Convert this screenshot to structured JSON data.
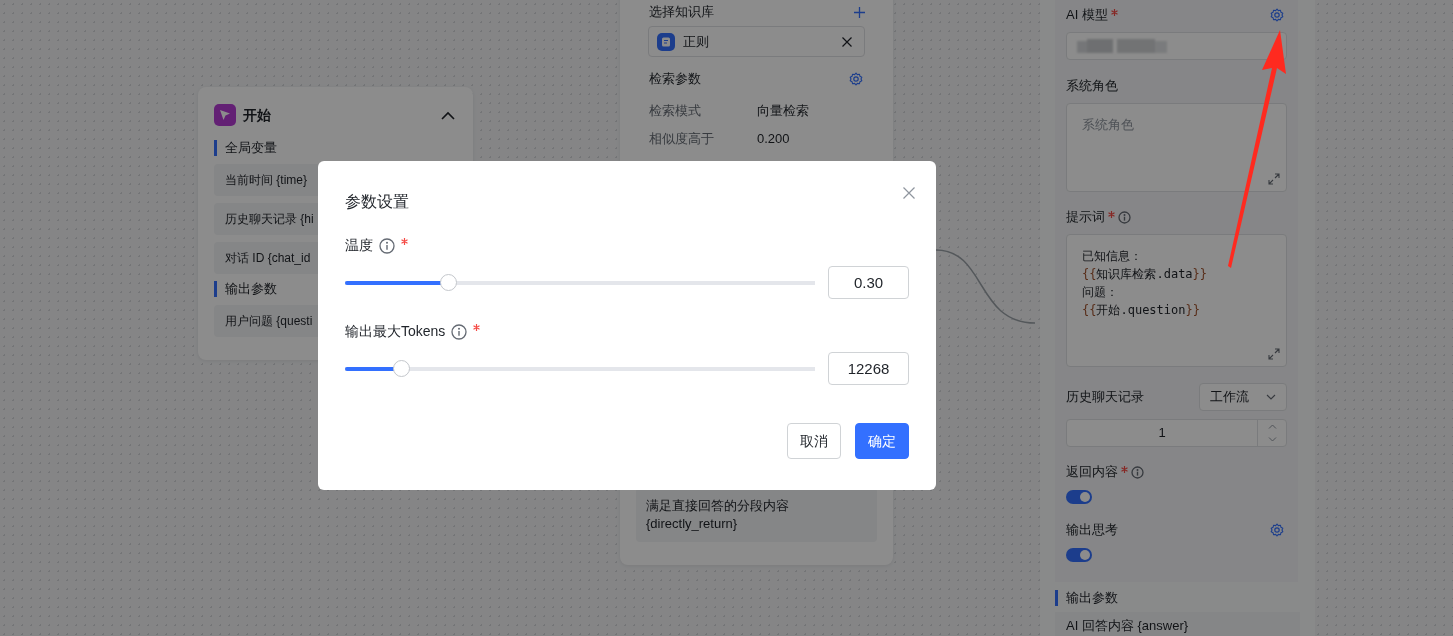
{
  "start_node": {
    "title": "开始",
    "expanded": true,
    "sections": [
      {
        "heading": "全局变量",
        "items": [
          "当前时间 {time}",
          "历史聊天记录 {hi",
          "对话 ID {chat_id"
        ]
      },
      {
        "heading": "输出参数",
        "items": [
          "用户问题 {questi"
        ]
      }
    ]
  },
  "knowledge_node": {
    "kb_label": "选择知识库",
    "knowledge_bases": [
      {
        "name": "正则"
      }
    ],
    "params_title": "检索参数",
    "params": [
      {
        "label": "检索模式",
        "value": "向量检索"
      },
      {
        "label": "相似度高于",
        "value": "0.200"
      }
    ],
    "output_item": "满足直接回答的分段内容 {directly_return}"
  },
  "ai_node": {
    "model_label": "AI 模型",
    "model_required": true,
    "system_role_label": "系统角色",
    "system_role_placeholder": "系统角色",
    "prompt_label": "提示词",
    "prompt_required": true,
    "prompt_lines": [
      "已知信息：",
      "{{知识库检索.data}}",
      "问题：",
      "{{开始.question}}"
    ],
    "history_label": "历史聊天记录",
    "history_mode": "工作流",
    "history_count": "1",
    "return_label": "返回内容",
    "return_required": true,
    "return_on": true,
    "thinking_label": "输出思考",
    "thinking_on": true,
    "output_heading": "输出参数",
    "output_items": [
      "AI 回答内容 {answer}"
    ]
  },
  "dialog": {
    "title": "参数设置",
    "fields": [
      {
        "label": "温度",
        "required": true,
        "level": 0.22,
        "value": "0.30"
      },
      {
        "label": "输出最大Tokens",
        "required": true,
        "level": 0.12,
        "value": "12268"
      }
    ],
    "buttons": [
      {
        "label": "取消",
        "kind": "secondary"
      },
      {
        "label": "确定",
        "kind": "primary"
      }
    ]
  }
}
